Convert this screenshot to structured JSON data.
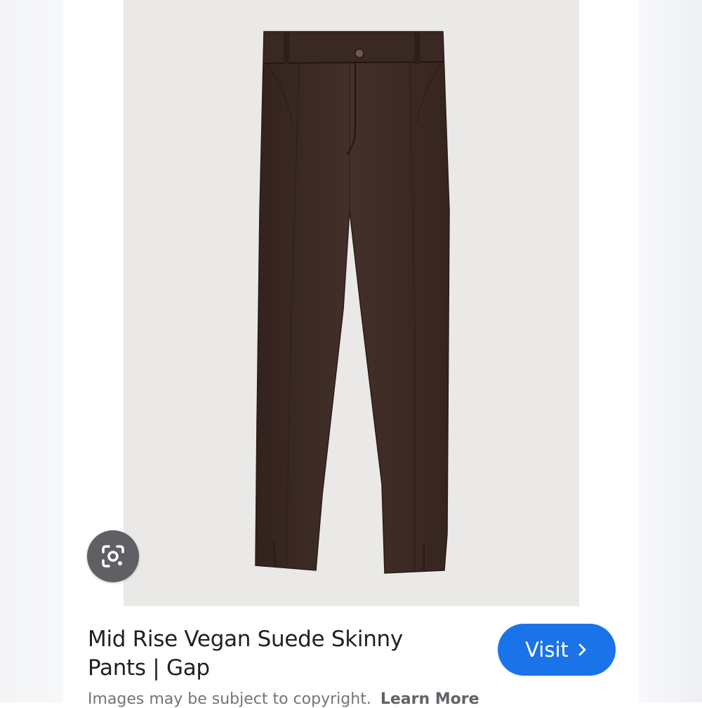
{
  "result": {
    "title_line1": "Mid Rise Vegan Suede Skinny",
    "title_line2": "Pants | Gap",
    "visit_label": "Visit",
    "visit_icon": "chevron-right-icon",
    "copyright_text": "Images may be subject to copyright.",
    "learn_more_label": "Learn More"
  },
  "image": {
    "subject": "brown suede skinny pants",
    "lens_icon": "google-lens-icon"
  },
  "colors": {
    "accent": "#1a73e8",
    "lens_button": "#5f6063",
    "product": "#3e2923"
  }
}
